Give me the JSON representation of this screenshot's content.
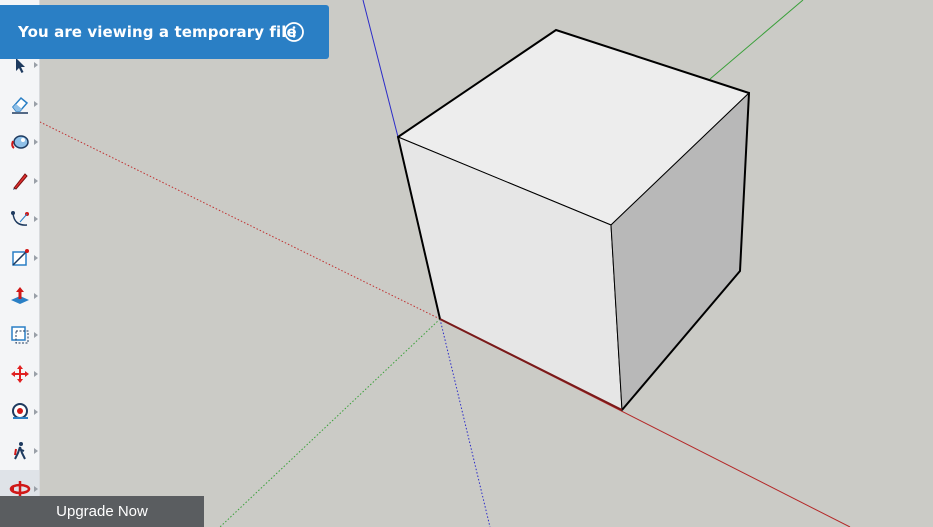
{
  "banner": {
    "text": "You are viewing a temporary file",
    "info_icon": "info-icon"
  },
  "upgrade": {
    "label": "Upgrade Now"
  },
  "toolbar": {
    "logo_icon": "sketchup-logo-icon",
    "tools": [
      {
        "name": "select-tool",
        "icon": "arrow-cursor-icon",
        "has_submenu": true
      },
      {
        "name": "eraser-tool",
        "icon": "eraser-icon",
        "has_submenu": true
      },
      {
        "name": "paint-bucket-tool",
        "icon": "paint-bucket-icon",
        "has_submenu": true
      },
      {
        "name": "line-tool",
        "icon": "pencil-icon",
        "has_submenu": true
      },
      {
        "name": "arc-tool",
        "icon": "arc-icon",
        "has_submenu": true
      },
      {
        "name": "rectangle-tool",
        "icon": "rectangle-icon",
        "has_submenu": true
      },
      {
        "name": "push-pull-tool",
        "icon": "push-pull-icon",
        "has_submenu": true
      },
      {
        "name": "offset-tool",
        "icon": "offset-icon",
        "has_submenu": true
      },
      {
        "name": "move-tool",
        "icon": "move-icon",
        "has_submenu": true
      },
      {
        "name": "tape-measure-tool",
        "icon": "tape-measure-icon",
        "has_submenu": true
      },
      {
        "name": "walk-tool",
        "icon": "walk-icon",
        "has_submenu": true
      },
      {
        "name": "orbit-tool",
        "icon": "orbit-icon",
        "has_submenu": true,
        "active": true
      }
    ]
  },
  "colors": {
    "background": "#cbcbc6",
    "banner": "#2a7fc5",
    "upgrade_button": "#5a5d60",
    "axis_red": "#b42828",
    "axis_green": "#3aa03a",
    "axis_blue": "#2c2cc8"
  }
}
